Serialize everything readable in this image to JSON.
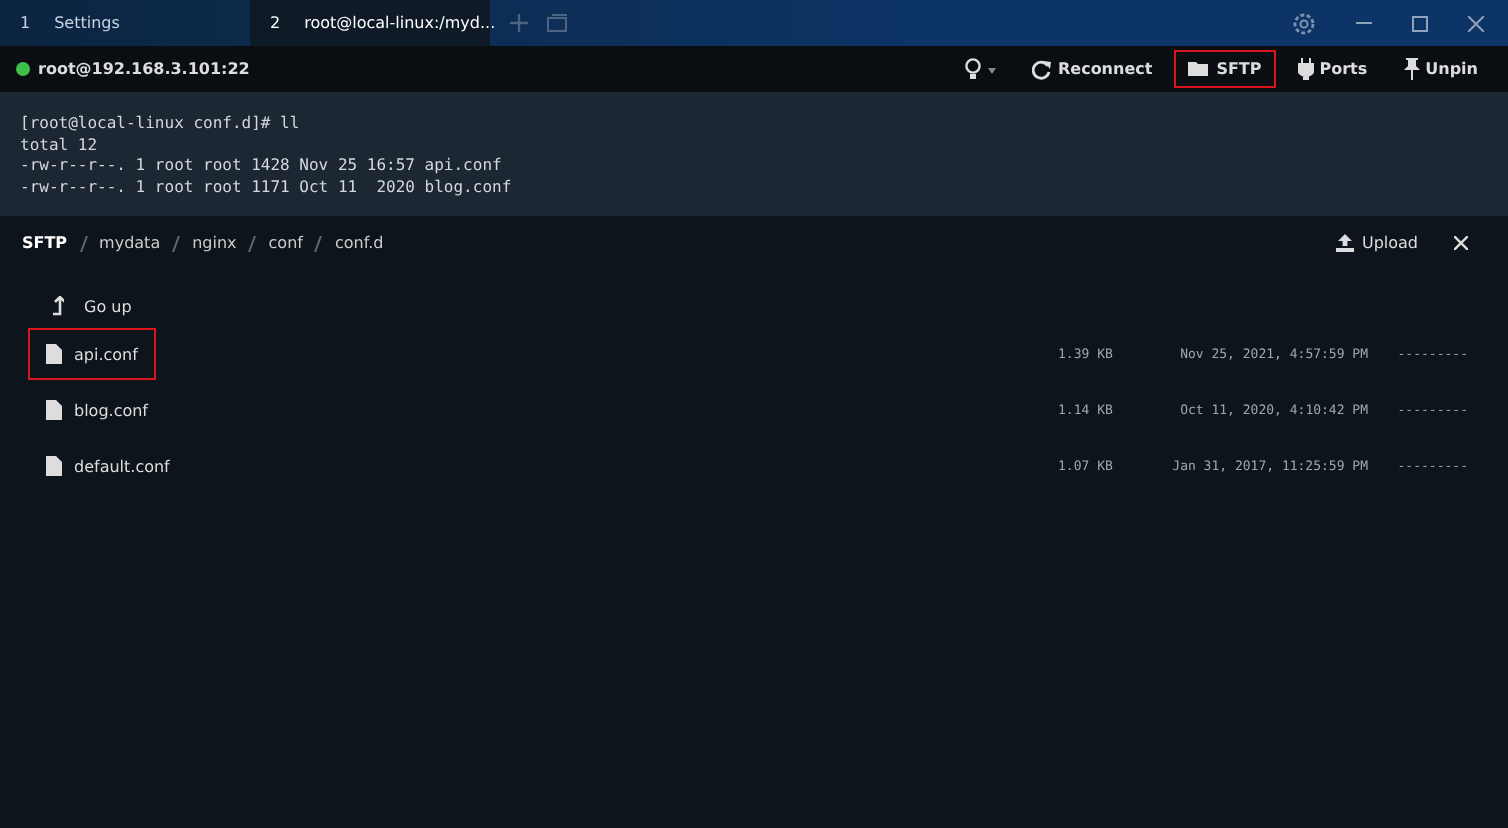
{
  "tabs": [
    {
      "number": "1",
      "label": "Settings",
      "selected": false
    },
    {
      "number": "2",
      "label": "root@local-linux:/myd...",
      "selected": true
    }
  ],
  "connection": {
    "host": "root@192.168.3.101:22",
    "connected": true
  },
  "toolbar": [
    {
      "kind": "bulb",
      "highlighted": false
    },
    {
      "kind": "reconnect",
      "label": "Reconnect",
      "highlighted": false
    },
    {
      "kind": "sftp",
      "label": "SFTP",
      "highlighted": true
    },
    {
      "kind": "ports",
      "label": "Ports",
      "highlighted": false
    },
    {
      "kind": "unpin",
      "label": "Unpin",
      "highlighted": false
    }
  ],
  "terminal": {
    "lines": [
      "[root@local-linux conf.d]# ll",
      "total 12",
      "-rw-r--r--. 1 root root 1428 Nov 25 16:57 api.conf",
      "-rw-r--r--. 1 root root 1171 Oct 11  2020 blog.conf"
    ]
  },
  "sftp": {
    "breadcrumb": [
      "SFTP",
      "mydata",
      "nginx",
      "conf",
      "conf.d"
    ],
    "upload": "Upload",
    "go_up": "Go up",
    "files": [
      {
        "name": "api.conf",
        "size": "1.39 KB",
        "modified": "Nov 25, 2021, 4:57:59 PM",
        "mode": "---------",
        "highlighted": true
      },
      {
        "name": "blog.conf",
        "size": "1.14 KB",
        "modified": "Oct 11, 2020, 4:10:42 PM",
        "mode": "---------",
        "highlighted": false
      },
      {
        "name": "default.conf",
        "size": "1.07 KB",
        "modified": "Jan 31, 2017, 11:25:59 PM",
        "mode": "---------",
        "highlighted": false
      }
    ]
  }
}
